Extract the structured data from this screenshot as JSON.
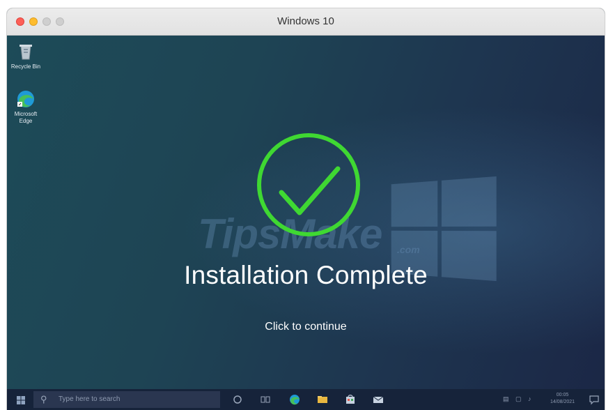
{
  "window": {
    "title": "Windows 10"
  },
  "desktop": {
    "icons": [
      {
        "label": "Recycle Bin",
        "icon": "recycle-bin-icon"
      },
      {
        "label": "Microsoft Edge",
        "icon": "edge-icon"
      }
    ],
    "watermark": "TipsMake",
    "watermark_suffix": ".com"
  },
  "dialog": {
    "headline": "Installation Complete",
    "continue_label": "Click to continue",
    "check_color": "#3fd832"
  },
  "taskbar": {
    "search_placeholder": "Type here to search",
    "pinned": [
      "cortana-icon",
      "task-view-icon",
      "edge-icon",
      "file-explorer-icon",
      "store-icon",
      "mail-icon"
    ],
    "clock_time": "00:05",
    "clock_date": "14/08/2021"
  },
  "colors": {
    "close": "#fd5f57",
    "minimize": "#febc2e",
    "taskbar": "#16233a"
  }
}
